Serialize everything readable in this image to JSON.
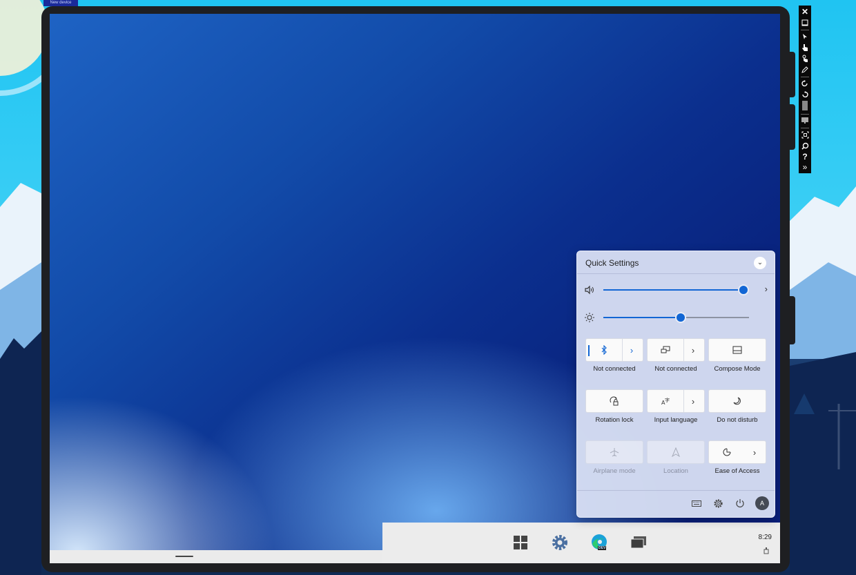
{
  "host": {
    "tag_label": "New device"
  },
  "emulator_toolbar": {
    "buttons": [
      "close-icon",
      "minimize-icon",
      "pointer-icon",
      "touch-icon",
      "multi-touch-icon",
      "pen-icon",
      "rotate-left-icon",
      "rotate-right-icon",
      "fit-screen-icon",
      "monitor-icon",
      "screenshot-icon",
      "zoom-icon",
      "help-icon",
      "expand-icon"
    ]
  },
  "quick_settings": {
    "title": "Quick Settings",
    "volume": {
      "level": 0.96,
      "icon": "speaker-icon"
    },
    "brightness": {
      "level": 0.53,
      "icon": "brightness-icon"
    },
    "accent": "#1266d4",
    "tiles": [
      {
        "label": "Not connected",
        "icon": "bluetooth-icon",
        "has_arrow": true,
        "active": true,
        "enabled": true
      },
      {
        "label": "Not connected",
        "icon": "project-icon",
        "has_arrow": true,
        "active": false,
        "enabled": true
      },
      {
        "label": "Compose Mode",
        "icon": "compose-icon",
        "has_arrow": false,
        "active": false,
        "enabled": true
      },
      {
        "label": "Rotation lock",
        "icon": "rotation-lock-icon",
        "has_arrow": false,
        "active": false,
        "enabled": true
      },
      {
        "label": "Input language",
        "icon": "input-language-icon",
        "has_arrow": true,
        "active": false,
        "enabled": true
      },
      {
        "label": "Do not disturb",
        "icon": "moon-icon",
        "has_arrow": false,
        "active": false,
        "enabled": true
      },
      {
        "label": "Airplane mode",
        "icon": "airplane-icon",
        "has_arrow": false,
        "active": false,
        "enabled": false
      },
      {
        "label": "Location",
        "icon": "location-icon",
        "has_arrow": false,
        "active": false,
        "enabled": false
      },
      {
        "label": "Ease of Access",
        "icon": "accessibility-icon",
        "has_arrow": true,
        "active": false,
        "enabled": true
      }
    ],
    "footer": {
      "avatar_initial": "A"
    }
  },
  "taskbar": {
    "icons": [
      "windows-start-icon",
      "settings-gear-icon",
      "edge-dev-icon",
      "task-view-icon"
    ],
    "edge_badge": "DEV",
    "time": "8:29"
  }
}
